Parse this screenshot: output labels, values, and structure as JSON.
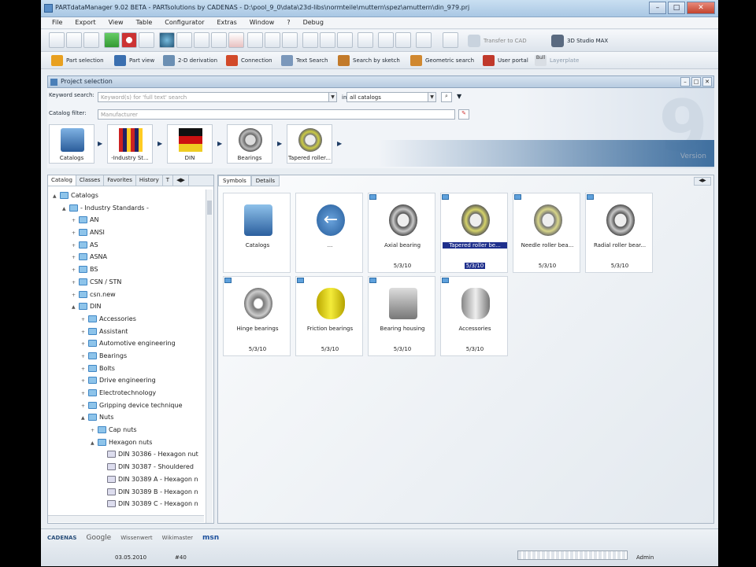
{
  "window": {
    "title": "PARTdataManager 9.02 BETA - PARTsolutions by CADENAS - D:\\pool_9_0\\data\\23d-libs\\normteile\\muttern\\spez\\amuttern\\din_979.prj",
    "min": "–",
    "max": "□",
    "close": "✕"
  },
  "menu": [
    "File",
    "Export",
    "View",
    "Table",
    "Configurator",
    "Extras",
    "Window",
    "?",
    "Debug"
  ],
  "toolbar1": {
    "transfer": "Transfer to CAD",
    "studio": "3D Studio MAX"
  },
  "toolbar2": [
    {
      "label": "Part selection",
      "color": "#e8a020"
    },
    {
      "label": "Part view",
      "color": "#3a6fb0"
    },
    {
      "label": "2-D derivation",
      "color": "#6b8fb3"
    },
    {
      "label": "Connection",
      "color": "#d24a2a"
    },
    {
      "label": "Text Search",
      "color": "#7b98bb"
    },
    {
      "label": "Search by sketch",
      "color": "#c27a2a"
    },
    {
      "label": "Geometric search",
      "color": "#d08830"
    },
    {
      "label": "User portal",
      "color": "#c0392b"
    },
    {
      "label": "Layerplate",
      "color": "#8a9aab"
    }
  ],
  "toolbar2_extra": "Bull",
  "project": {
    "title": "Project selection"
  },
  "search": {
    "keyword_label": "Keyword search:",
    "keyword_placeholder": "Keyword(s) for 'full text' search",
    "in_label": "in",
    "in_value": "all catalogs",
    "filter_label": "Catalog filter:",
    "filter_placeholder": "Manufacturer"
  },
  "breadcrumbs": [
    {
      "label": "Catalogs"
    },
    {
      "label": "-Industry St..."
    },
    {
      "label": "DIN"
    },
    {
      "label": "Bearings"
    },
    {
      "label": "Tapered roller..."
    }
  ],
  "brand": {
    "nine": "9",
    "version": "Version"
  },
  "left_tabs": [
    "Catalog",
    "Classes",
    "Favorites",
    "History",
    "T"
  ],
  "tree": [
    {
      "label": "Catalogs",
      "level": 0,
      "exp": "▲"
    },
    {
      "label": "- Industry Standards -",
      "level": 1,
      "exp": "▲"
    },
    {
      "label": "AN",
      "level": 2,
      "exp": "+"
    },
    {
      "label": "ANSI",
      "level": 2,
      "exp": "+"
    },
    {
      "label": "AS",
      "level": 2,
      "exp": "+"
    },
    {
      "label": "ASNA",
      "level": 2,
      "exp": "+"
    },
    {
      "label": "BS",
      "level": 2,
      "exp": "+"
    },
    {
      "label": "CSN / STN",
      "level": 2,
      "exp": "+"
    },
    {
      "label": "csn.new",
      "level": 2,
      "exp": "+"
    },
    {
      "label": "DIN",
      "level": 2,
      "exp": "▲"
    },
    {
      "label": "Accessories",
      "level": 3,
      "exp": "+"
    },
    {
      "label": "Assistant",
      "level": 3,
      "exp": "+"
    },
    {
      "label": "Automotive engineering",
      "level": 3,
      "exp": "+"
    },
    {
      "label": "Bearings",
      "level": 3,
      "exp": "+"
    },
    {
      "label": "Bolts",
      "level": 3,
      "exp": "+"
    },
    {
      "label": "Drive engineering",
      "level": 3,
      "exp": "+"
    },
    {
      "label": "Electrotechnology",
      "level": 3,
      "exp": "+"
    },
    {
      "label": "Gripping device technique",
      "level": 3,
      "exp": "+"
    },
    {
      "label": "Nuts",
      "level": 3,
      "exp": "▲"
    },
    {
      "label": "Cap nuts",
      "level": 4,
      "exp": "+"
    },
    {
      "label": "Hexagon nuts",
      "level": 4,
      "exp": "▲"
    },
    {
      "label": "DIN 30386 - Hexagon nut",
      "level": 5,
      "exp": ""
    },
    {
      "label": "DIN 30387 - Shouldered",
      "level": 5,
      "exp": ""
    },
    {
      "label": "DIN 30389 A - Hexagon n",
      "level": 5,
      "exp": ""
    },
    {
      "label": "DIN 30389 B - Hexagon n",
      "level": 5,
      "exp": ""
    },
    {
      "label": "DIN 30389 C - Hexagon n",
      "level": 5,
      "exp": ""
    }
  ],
  "right_tabs": [
    "Symbols",
    "Details"
  ],
  "tiles": [
    {
      "label": "Catalogs",
      "date": "",
      "type": "catalogs"
    },
    {
      "label": "...",
      "date": "",
      "type": "back"
    },
    {
      "label": "Axial bearing",
      "date": "5/3/10",
      "type": "bearing"
    },
    {
      "label": "Tapered roller be...",
      "date": "5/3/10",
      "type": "tapered",
      "selected": true
    },
    {
      "label": "Needle roller bea...",
      "date": "5/3/10",
      "type": "needle"
    },
    {
      "label": "Radial roller bear...",
      "date": "5/3/10",
      "type": "bearing"
    },
    {
      "label": "Hinge bearings",
      "date": "5/3/10",
      "type": "hinge"
    },
    {
      "label": "Friction bearings",
      "date": "5/3/10",
      "type": "friction"
    },
    {
      "label": "Bearing housing",
      "date": "5/3/10",
      "type": "housing"
    },
    {
      "label": "Accessories",
      "date": "5/3/10",
      "type": "accessory"
    }
  ],
  "footer": {
    "logos": [
      "CADENAS",
      "Google",
      "Wissenwert",
      "Wikimaster",
      "msn"
    ],
    "date": "03.05.2010",
    "count": "#40",
    "user": "Admin"
  }
}
